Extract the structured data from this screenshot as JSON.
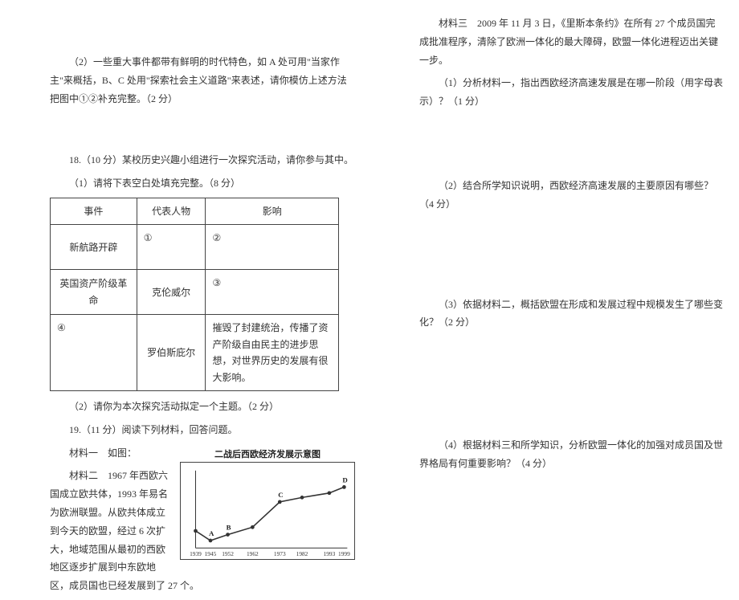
{
  "left": {
    "q17_2": "（2）一些重大事件都带有鲜明的时代特色，如 A 处可用\"当家作主\"来概括，B、C 处用\"探索社会主义道路\"来表述，请你模仿上述方法把图中①②补充完整。（2 分）",
    "q18_intro": "18.（10 分）某校历史兴趣小组进行一次探究活动，请你参与其中。",
    "q18_1": "（1）请将下表空白处填充完整。（8 分）",
    "tbl": {
      "h1": "事件",
      "h2": "代表人物",
      "h3": "影响",
      "r1c1": "新航路开辟",
      "r1c2": "①",
      "r1c3": "②",
      "r2c1": "英国资产阶级革命",
      "r2c2": "克伦威尔",
      "r2c3": "③",
      "r3c1": "④",
      "r3c2": "罗伯斯庇尔",
      "r3c3": "摧毁了封建统治，传播了资产阶级自由民主的进步思想，对世界历史的发展有很大影响。"
    },
    "q18_2": "（2）请你为本次探究活动拟定一个主题。（2 分）",
    "q19_intro": "19.（11 分）阅读下列材料，回答问题。",
    "mat1": "材料一　如图：",
    "mat2": "材料二　1967 年西欧六国成立欧共体，1993 年易名为欧洲联盟。从欧共体成立到今天的欧盟，经过 6 次扩大，地域范围从最初的西欧地区逐步扩展到中东欧地区，成员国也已经发展到了 27 个。"
  },
  "right": {
    "mat3": "材料三　2009 年 11 月 3 日，《里斯本条约》在所有 27 个成员国完成批准程序，清除了欧洲一体化的最大障碍，欧盟一体化进程迈出关键一步。",
    "q1": "（1）分析材料一，指出西欧经济高速发展是在哪一阶段（用字母表示）？（1 分）",
    "q2": "（2）结合所学知识说明，西欧经济高速发展的主要原因有哪些？（4 分）",
    "q3": "（3）依据材料二，概括欧盟在形成和发展过程中规模发生了哪些变化？（2 分）",
    "q4": "（4）根据材料三和所学知识，分析欧盟一体化的加强对成员国及世界格局有何重要影响？（4 分）"
  },
  "chart_data": {
    "type": "line",
    "title": "二战后西欧经济发展示意图",
    "x": [
      1939,
      1945,
      1952,
      1962,
      1973,
      1982,
      1993,
      1999
    ],
    "series": [
      {
        "name": "西欧经济",
        "values": [
          23,
          10,
          18,
          28,
          62,
          68,
          74,
          82
        ]
      }
    ],
    "labels": [
      {
        "name": "A",
        "x": 1945,
        "y": 10
      },
      {
        "name": "B",
        "x": 1952,
        "y": 18
      },
      {
        "name": "C",
        "x": 1973,
        "y": 62
      },
      {
        "name": "D",
        "x": 1999,
        "y": 82
      }
    ],
    "xlabel": "",
    "ylabel": "",
    "ylim": [
      0,
      100
    ]
  }
}
